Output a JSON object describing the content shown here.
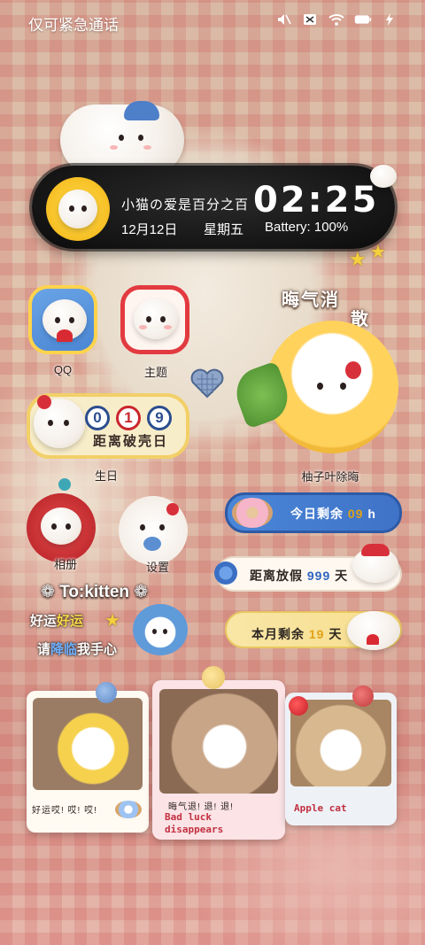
{
  "status_bar": {
    "carrier_text": "仅可紧急通话",
    "icons": [
      "mute-icon",
      "sim-blocked-icon",
      "wifi-icon",
      "battery-icon",
      "charging-icon"
    ]
  },
  "clock_widget": {
    "slogan": "小猫の爱是百分之百",
    "time": "02:25",
    "date": "12月12日",
    "weekday": "星期五",
    "battery": "Battery: 100%"
  },
  "apps": [
    {
      "label": "QQ"
    },
    {
      "label": "主题"
    },
    {
      "label": "生日"
    },
    {
      "label": "相册"
    },
    {
      "label": "设置"
    }
  ],
  "birthday_widget": {
    "digits": [
      "0",
      "1",
      "9"
    ],
    "text": "距离破壳日"
  },
  "mood_sticker": {
    "title_line1": "晦气消",
    "title_line2": "散",
    "label": "柚子叶除晦"
  },
  "countdowns": {
    "today_prefix": "今日剩余",
    "today_value": "09",
    "today_unit": "h",
    "holiday_prefix": "距离放假",
    "holiday_value": "999",
    "holiday_unit": "天",
    "month_prefix": "本月剩余",
    "month_value": "19",
    "month_unit": "天"
  },
  "stickers": {
    "to_kitten": "To:kitten",
    "luck_a": "好运",
    "luck_b": "好运",
    "please_a": "请",
    "please_b": "降临",
    "please_c": "我手心"
  },
  "cards": {
    "card1_caption": "好运哎! 哎! 哎!",
    "card2_caption": "晦气退! 退! 退!",
    "card2_en_line1": "Bad luck",
    "card2_en_line2": "disappears",
    "card3_caption": "Apple cat"
  },
  "colors": {
    "accent_yellow": "#f7c227",
    "accent_blue": "#4a86d8",
    "accent_red": "#c9262d"
  }
}
